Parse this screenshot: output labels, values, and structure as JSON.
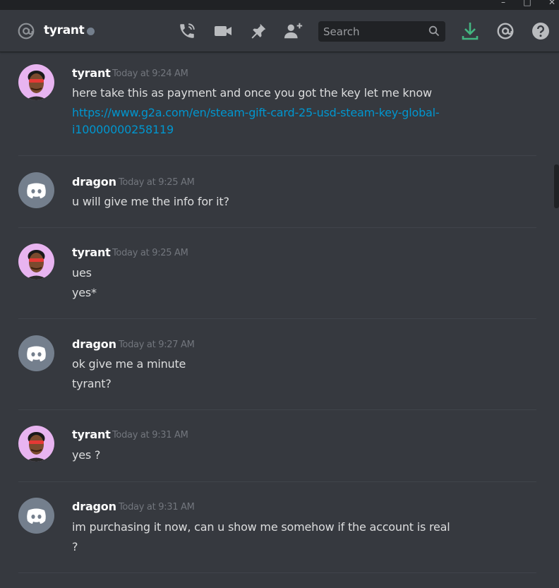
{
  "header": {
    "channel_name": "tyrant",
    "search_placeholder": "Search",
    "accent_green": "#43b581",
    "icons": [
      "at-icon",
      "start-voice-call-icon",
      "start-video-call-icon",
      "pinned-messages-icon",
      "add-friends-to-dm-icon",
      "search-icon",
      "download-icon",
      "mentions-icon",
      "help-icon"
    ]
  },
  "window_controls": [
    "minimize",
    "maximize",
    "close"
  ],
  "messages": [
    {
      "author": "tyrant",
      "timestamp": "Today at 9:24 AM",
      "lines": [
        "here take this as payment and once you got the key let me know"
      ],
      "link_lines": [
        "https://www.g2a.com/en/steam-gift-card-25-usd-steam-key-global-",
        "i10000000258119"
      ]
    },
    {
      "author": "dragon",
      "timestamp": "Today at 9:25 AM",
      "lines": [
        "u will give me the info for it?"
      ]
    },
    {
      "author": "tyrant",
      "timestamp": "Today at 9:25 AM",
      "lines": [
        "ues",
        "yes*"
      ]
    },
    {
      "author": "dragon",
      "timestamp": "Today at 9:27 AM",
      "lines": [
        "ok give me a minute",
        "tyrant?"
      ]
    },
    {
      "author": "tyrant",
      "timestamp": "Today at 9:31 AM",
      "lines": [
        "yes ?"
      ]
    },
    {
      "author": "dragon",
      "timestamp": "Today at 9:31 AM",
      "lines": [
        "im purchasing it now, can u show me somehow if the account is real",
        "?"
      ]
    }
  ]
}
